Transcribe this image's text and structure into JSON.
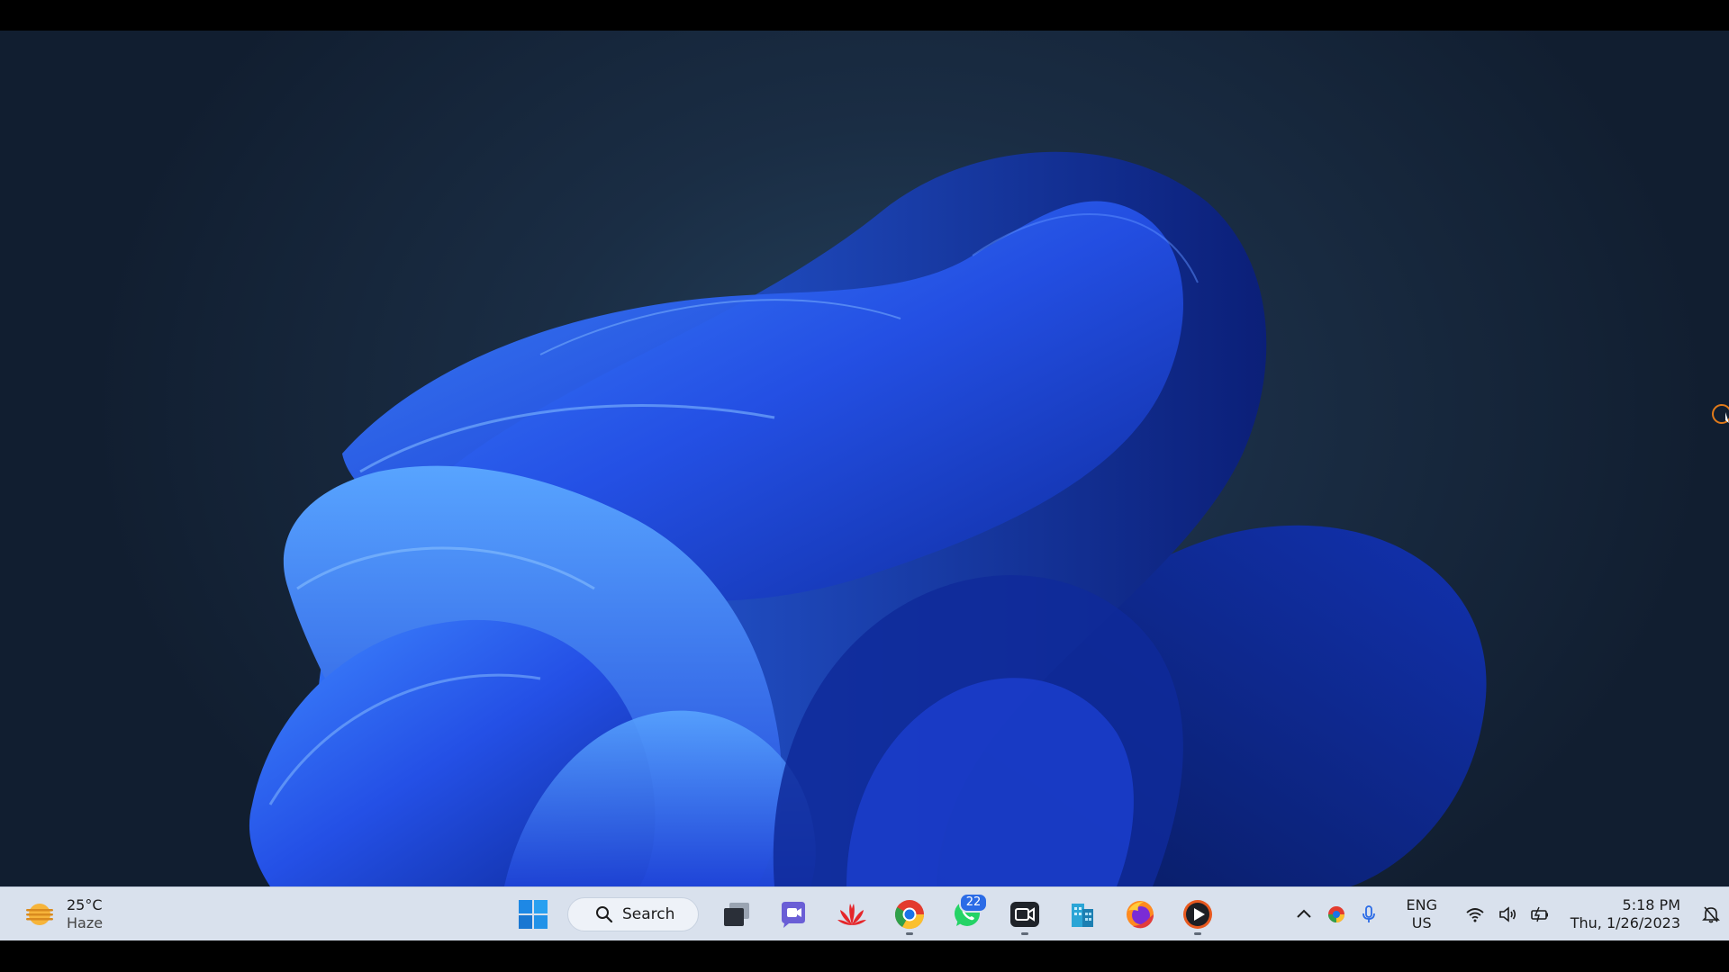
{
  "weather": {
    "temperature": "25°C",
    "condition": "Haze",
    "icon": "haze-sun-icon"
  },
  "taskbar": {
    "search_label": "Search",
    "pinned": [
      {
        "name": "start-button",
        "icon": "windows-logo-icon",
        "running": false
      },
      {
        "name": "task-view-button",
        "icon": "task-view-icon",
        "running": false
      },
      {
        "name": "teams-chat-button",
        "icon": "teams-video-icon",
        "running": false
      },
      {
        "name": "huawei-app-button",
        "icon": "huawei-logo-icon",
        "running": false
      },
      {
        "name": "chrome-button",
        "icon": "chrome-icon",
        "running": true
      },
      {
        "name": "whatsapp-button",
        "icon": "whatsapp-icon",
        "running": false,
        "badge": "22"
      },
      {
        "name": "camera-app-button",
        "icon": "camera-icon",
        "running": true
      },
      {
        "name": "office-app-button",
        "icon": "office-building-icon",
        "running": false
      },
      {
        "name": "firefox-button",
        "icon": "firefox-icon",
        "running": false
      },
      {
        "name": "media-player-button",
        "icon": "play-icon",
        "running": true
      }
    ]
  },
  "tray": {
    "language": {
      "line1": "ENG",
      "line2": "US"
    },
    "time": "5:18 PM",
    "date": "Thu, 1/26/2023"
  },
  "colors": {
    "accent": "#2b6be6",
    "taskbar_bg": "#d9e1ed",
    "wallpaper_bloom": "#2a5cf5"
  }
}
